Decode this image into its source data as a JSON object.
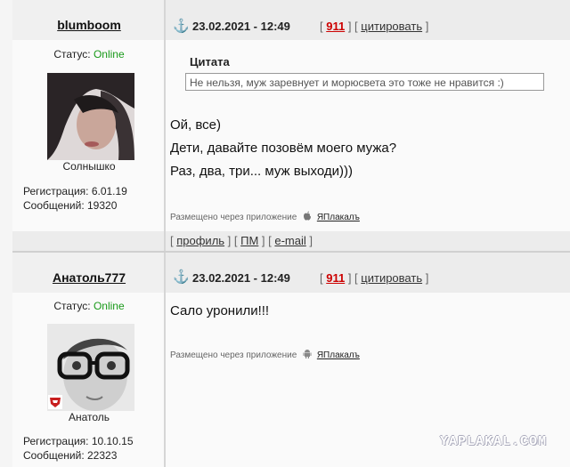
{
  "posts": [
    {
      "username": "blumboom",
      "status_label": "Статус:",
      "status_value": "Online",
      "avatar_caption": "Солнышко",
      "registration": "Регистрация: 6.01.19",
      "messages": "Сообщений: 19320",
      "date": "23.02.2021 - 12:49",
      "post_number": "911",
      "quote_link": "цитировать",
      "quote_title": "Цитата",
      "quote_text": "Не нельзя, муж заревнует и морюсвета это тоже не нравится :)",
      "body_lines": [
        "Ой, все)",
        "Дети, давайте позовём моего мужа?",
        "Раз, два, три... муж выходи)))"
      ],
      "via_text": "Размещено через приложение",
      "via_app": "ЯПлакалъ",
      "via_platform": "apple-icon",
      "footer_links": [
        "профиль",
        "ПМ",
        "e-mail"
      ]
    },
    {
      "username": "Анатоль777",
      "status_label": "Статус:",
      "status_value": "Online",
      "avatar_caption": "Анатоль",
      "registration": "Регистрация: 10.10.15",
      "messages": "Сообщений: 22323",
      "date": "23.02.2021 - 12:49",
      "post_number": "911",
      "quote_link": "цитировать",
      "body_lines": [
        "Сало уронили!!!"
      ],
      "via_text": "Размещено через приложение",
      "via_app": "ЯПлакалъ",
      "via_platform": "android-icon"
    }
  ],
  "watermark": "YAPLAKAL.COM",
  "colors": {
    "online": "#1a9a1a",
    "post_number": "#cc0000",
    "anchor": "#2a6fb5"
  }
}
